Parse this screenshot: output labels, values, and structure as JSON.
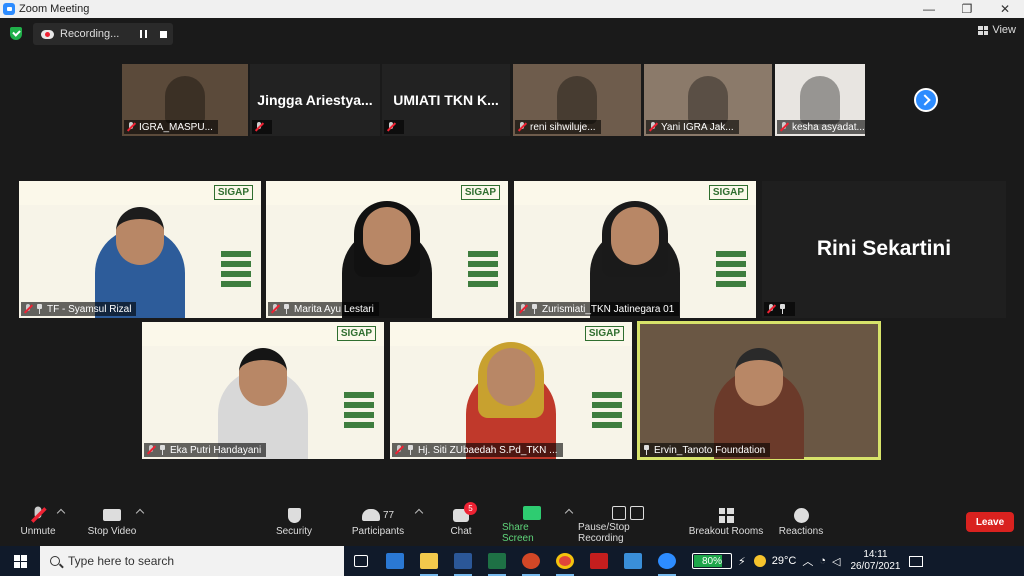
{
  "window": {
    "title": "Zoom Meeting",
    "minimize": "—",
    "restore": "❐",
    "close": "✕"
  },
  "recording": {
    "label": "Recording..."
  },
  "view": {
    "label": "View"
  },
  "strip": [
    {
      "name": "IGRA_MASPU...",
      "show_name": false,
      "bg": "#5b4a3a"
    },
    {
      "name": "",
      "show_name": true,
      "big": "Jingga  Ariestya...",
      "bg": "#222222"
    },
    {
      "name": "",
      "show_name": true,
      "big": "UMIATI  TKN  K...",
      "bg": "#222222"
    },
    {
      "name": "reni sihwiluje...",
      "show_name": false,
      "bg": "#6e5c4c"
    },
    {
      "name": "Yani IGRA Jak...",
      "show_name": false,
      "bg": "#8b7a6a"
    },
    {
      "name": "kesha asyadat...",
      "show_name": false,
      "bg": "#e8e5e1"
    }
  ],
  "tiles": [
    {
      "name": "TF - Syamsul Rizal",
      "slide": true,
      "hair": "#1c1c1c",
      "shirt": "#2d5c9a",
      "hijab": ""
    },
    {
      "name": "Marita Ayu Lestari",
      "slide": true,
      "hair": "#111111",
      "shirt": "#151515",
      "hijab": "#111111"
    },
    {
      "name": "Zurismiati_TKN Jatinegara 01",
      "slide": true,
      "hair": "#121212",
      "shirt": "#1b1b1b",
      "hijab": "#1a1a1a"
    },
    {
      "name": "",
      "big": "Rini Sekartini",
      "slide": false
    },
    {
      "name": "Eka Putri Handayani",
      "slide": true,
      "hair": "#151515",
      "shirt": "#d8d8d8",
      "hijab": ""
    },
    {
      "name": "Hj. Siti ZUbaedah S.Pd_TKN ...",
      "slide": true,
      "hair": "#c0392b",
      "shirt": "#c0392b",
      "hijab": "#c8a12f"
    },
    {
      "name": "Ervin_Tanoto Foundation",
      "slide": false,
      "hair": "#2a2a2a",
      "shirt": "#6b3a2a",
      "hijab": "",
      "active": true
    }
  ],
  "slide_text": {
    "brand": "SIGAP"
  },
  "toolbar": {
    "unmute": "Unmute",
    "stop_video": "Stop Video",
    "security": "Security",
    "participants": "Participants",
    "participants_count": "77",
    "chat": "Chat",
    "chat_badge": "5",
    "share_screen": "Share Screen",
    "pause_stop": "Pause/Stop Recording",
    "breakout": "Breakout Rooms",
    "reactions": "Reactions",
    "leave": "Leave"
  },
  "taskbar": {
    "search_placeholder": "Type here to search",
    "battery_pct": "80%",
    "battery_level": 0.8,
    "temperature": "29°C",
    "time": "14:11",
    "date": "26/07/2021"
  },
  "colors": {
    "accent": "#2d8cff",
    "leave": "#d9221f",
    "share": "#5fd47a",
    "active_border": "#d7e36a"
  }
}
